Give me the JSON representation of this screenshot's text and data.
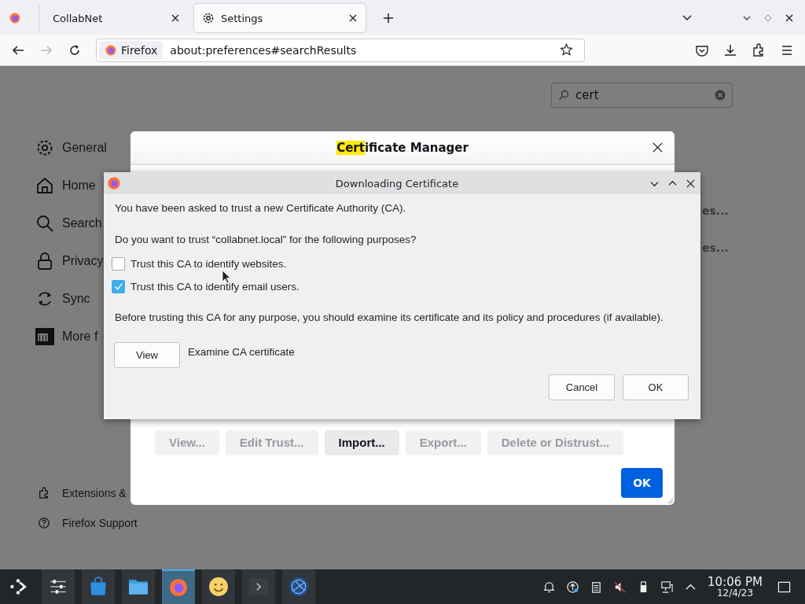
{
  "tabs": [
    {
      "label": "CollabNet",
      "selected": false
    },
    {
      "label": "Settings",
      "selected": true
    }
  ],
  "address_bar": {
    "identity": "Firefox",
    "url": "about:preferences#searchResults"
  },
  "settings": {
    "search": {
      "value": "cert"
    },
    "sidebar": [
      {
        "label": "General",
        "kind": "gear"
      },
      {
        "label": "Home",
        "kind": "home"
      },
      {
        "label": "Search",
        "kind": "search"
      },
      {
        "label": "Privacy",
        "kind": "lock"
      },
      {
        "label": "Sync",
        "kind": "sync"
      },
      {
        "label": "More f",
        "kind": "mono"
      }
    ],
    "footer": [
      {
        "label": "Extensions &",
        "kind": "puzzle"
      },
      {
        "label": "Firefox Support",
        "kind": "help"
      }
    ],
    "ghost_labels": [
      "es...",
      "es..."
    ]
  },
  "certificate_manager": {
    "title_highlight": "Cert",
    "title_rest": "ificate Manager",
    "buttons": [
      {
        "label": "View...",
        "disabled": true
      },
      {
        "label": "Edit Trust...",
        "disabled": true
      },
      {
        "label": "Import...",
        "disabled": false
      },
      {
        "label": "Export...",
        "disabled": true
      },
      {
        "label": "Delete or Distrust...",
        "disabled": true
      }
    ],
    "ok": "OK"
  },
  "dialog": {
    "title": "Downloading Certificate",
    "intro": "You have been asked to trust a new Certificate Authority (CA).",
    "question": "Do you want to trust “collabnet.local” for the following purposes?",
    "options": [
      {
        "label": "Trust this CA to identify websites.",
        "checked": false
      },
      {
        "label": "Trust this CA to identify email users.",
        "checked": true
      }
    ],
    "warning": "Before trusting this CA for any purpose, you should examine its certificate and its policy and procedures (if available).",
    "view_button": "View",
    "view_caption": "Examine CA certificate",
    "buttons": [
      "Cancel",
      "OK"
    ]
  },
  "taskbar": {
    "apps": [
      {
        "kind": "launcher",
        "selected": false
      },
      {
        "kind": "settings",
        "selected": false
      },
      {
        "kind": "store",
        "selected": false
      },
      {
        "kind": "folder",
        "selected": false
      },
      {
        "kind": "firefox",
        "selected": true
      },
      {
        "kind": "smiley",
        "selected": false
      },
      {
        "kind": "terminal",
        "selected": false
      },
      {
        "kind": "globe",
        "selected": false
      }
    ],
    "clock": {
      "time": "10:06 PM",
      "date": "12/4/23"
    }
  }
}
